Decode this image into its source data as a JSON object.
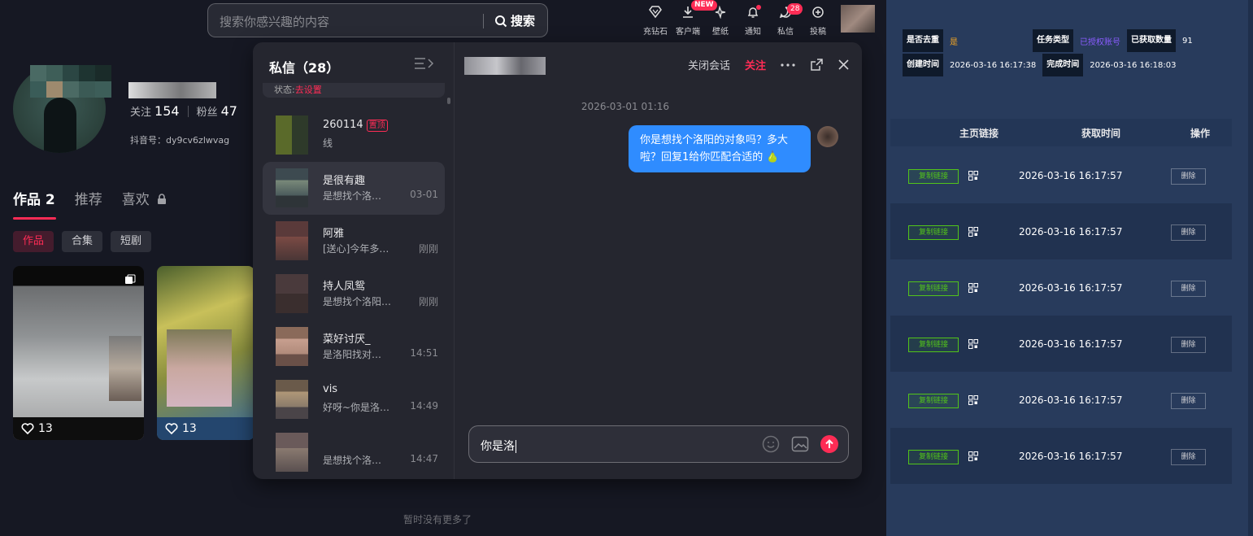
{
  "search": {
    "placeholder": "搜索你感兴趣的内容",
    "button": "搜索"
  },
  "nav": [
    {
      "label": "充钻石",
      "icon": "diamond-icon"
    },
    {
      "label": "客户端",
      "icon": "download-icon",
      "badge": "NEW"
    },
    {
      "label": "壁纸",
      "icon": "wallpaper-icon"
    },
    {
      "label": "通知",
      "icon": "bell-icon"
    },
    {
      "label": "私信",
      "icon": "message-icon",
      "badge": "28"
    },
    {
      "label": "投稿",
      "icon": "upload-icon"
    }
  ],
  "profile": {
    "following_label": "关注",
    "following": "154",
    "followers_label": "粉丝",
    "followers": "47",
    "douyin_id": "抖音号：dy9cv6zlwvag"
  },
  "tabs": [
    {
      "label": "作品 2"
    },
    {
      "label": "推荐"
    },
    {
      "label": "喜欢"
    }
  ],
  "chips": [
    "作品",
    "合集",
    "短剧"
  ],
  "videos": [
    {
      "likes": "13"
    },
    {
      "likes": "13"
    }
  ],
  "footer_text": "暂时没有更多了",
  "dm": {
    "title": "私信（28）",
    "top_text_prefix": "状态:",
    "top_text_red": "去设置",
    "conversations": [
      {
        "name": "260114",
        "pin": "置顶",
        "msg": "线",
        "time": ""
      },
      {
        "name": "是很有趣",
        "msg": "是想找个洛…",
        "time": "03-01"
      },
      {
        "name": "阿雅",
        "msg": "[送心]今年多…",
        "time": "刚刚"
      },
      {
        "name": "持人凤鸳",
        "msg": "是想找个洛阳…",
        "time": "刚刚"
      },
      {
        "name": "菜好讨厌_",
        "msg": "是洛阳找对…",
        "time": "14:51"
      },
      {
        "name": "vis",
        "msg": "好呀~你是洛…",
        "time": "14:49"
      },
      {
        "name": "",
        "msg": "是想找个洛…",
        "time": "14:47"
      }
    ],
    "chat": {
      "close_label": "关闭会话",
      "follow_label": "关注",
      "date": "2026-03-01 01:16",
      "message": "你是想找个洛阳的对象吗？多大啦？回复1给你匹配合适的 🍐",
      "draft": "你是洛"
    }
  },
  "admin": {
    "dedup_label": "是否去重",
    "dedup_value": "是",
    "task_type_label": "任务类型",
    "task_type_value": "已授权账号",
    "count_label": "已获取数量",
    "count_value": "91",
    "created_label": "创建时间",
    "created_value": "2026-03-16 16:17:38",
    "done_label": "完成时间",
    "done_value": "2026-03-16 16:18:03",
    "headers": [
      "主页链接",
      "获取时间",
      "操作"
    ],
    "rows": [
      {
        "copy": "复制链接",
        "time": "2026-03-16 16:17:57",
        "del": "删除"
      },
      {
        "copy": "复制链接",
        "time": "2026-03-16 16:17:57",
        "del": "删除"
      },
      {
        "copy": "复制链接",
        "time": "2026-03-16 16:17:57",
        "del": "删除"
      },
      {
        "copy": "复制链接",
        "time": "2026-03-16 16:17:57",
        "del": "删除"
      },
      {
        "copy": "复制链接",
        "time": "2026-03-16 16:17:57",
        "del": "删除"
      },
      {
        "copy": "复制链接",
        "time": "2026-03-16 16:17:57",
        "del": "删除"
      }
    ]
  },
  "colors": {
    "accent": "#fe2c55",
    "bubble": "#2f8cff",
    "admin_bg": "#283b5c",
    "success": "#52c41a",
    "task_type": "#8a5cff",
    "dedup": "#f5a623"
  }
}
